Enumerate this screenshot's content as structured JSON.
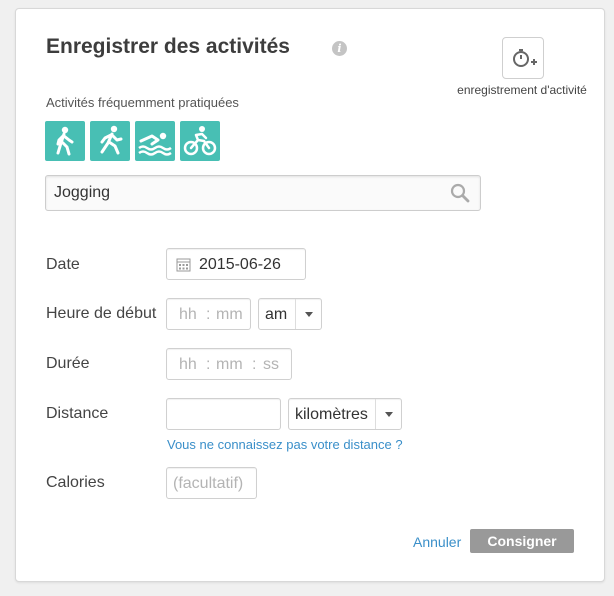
{
  "header": {
    "title": "Enregistrer des activités",
    "timer_caption": "enregistrement d'activité"
  },
  "frequent": {
    "label": "Activités fréquemment pratiquées",
    "icons": [
      "walking-icon",
      "running-icon",
      "swimming-icon",
      "cycling-icon"
    ]
  },
  "search": {
    "value": "Jogging",
    "icon": "search-icon"
  },
  "form": {
    "date_label": "Date",
    "date_value": "2015-06-26",
    "start_label": "Heure de début",
    "start_hh_placeholder": "hh",
    "start_sep": ":",
    "start_mm_placeholder": "mm",
    "ampm_value": "am",
    "duration_label": "Durée",
    "duration_hh_placeholder": "hh",
    "duration_sep1": ":",
    "duration_mm_placeholder": "mm",
    "duration_sep2": ":",
    "duration_ss_placeholder": "ss",
    "distance_label": "Distance",
    "distance_value": "",
    "distance_unit": "kilomètres",
    "distance_hint": "Vous ne connaissez pas votre distance ?",
    "calories_label": "Calories",
    "calories_placeholder": "(facultatif)"
  },
  "actions": {
    "cancel": "Annuler",
    "submit": "Consigner"
  },
  "colors": {
    "accent": "#48bfb4",
    "link": "#3a8fc9",
    "button": "#999999"
  }
}
